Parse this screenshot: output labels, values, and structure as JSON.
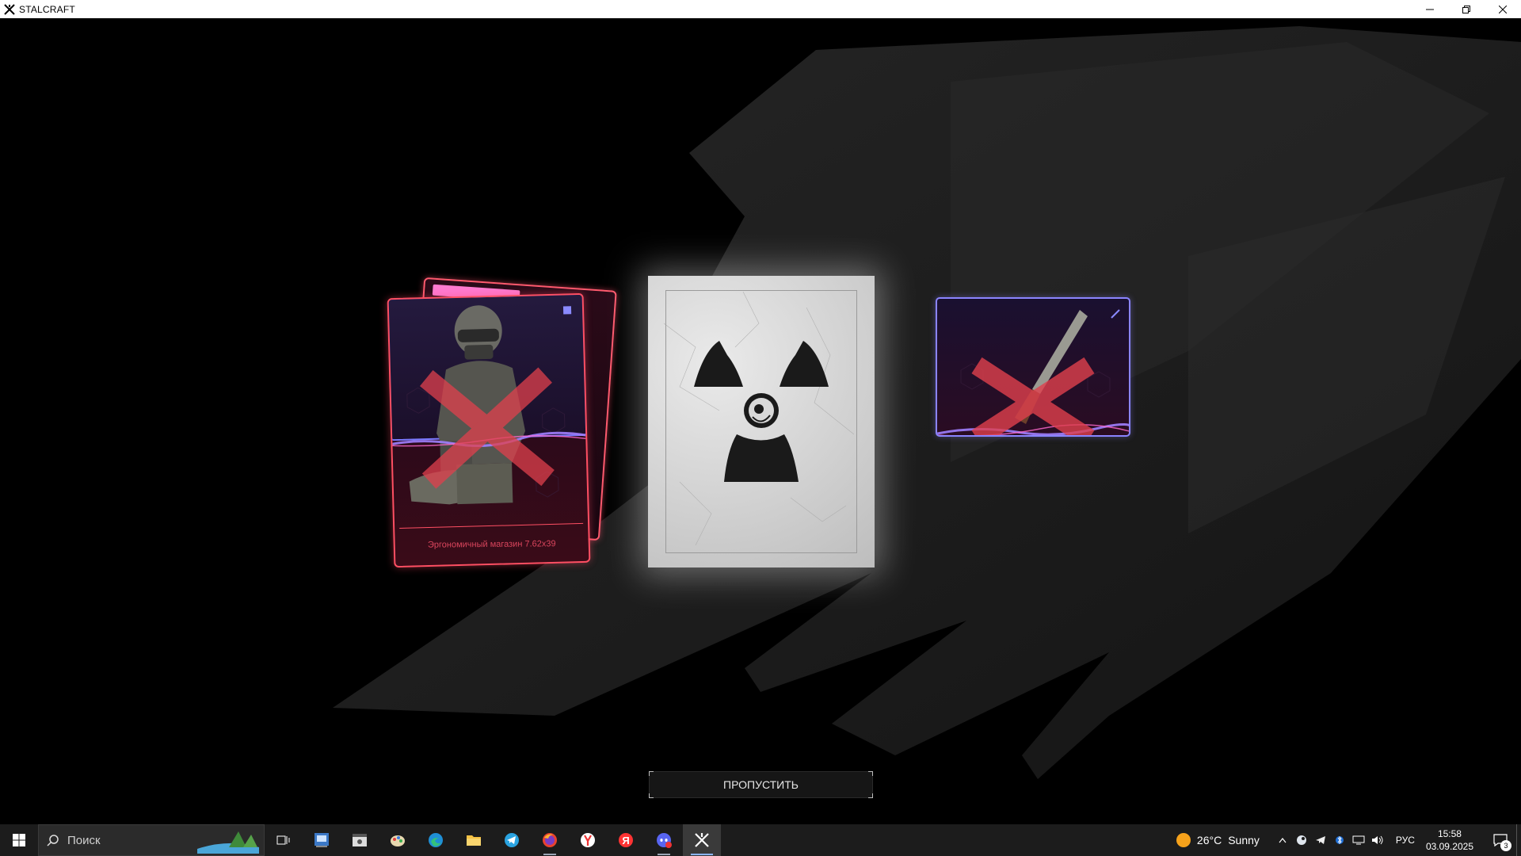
{
  "window": {
    "title": "STALCRAFT"
  },
  "cards": {
    "left_caption": "Эргономичный магазин 7.62x39"
  },
  "skip_button": {
    "label": "ПРОПУСТИТЬ"
  },
  "taskbar": {
    "search_placeholder": "Поиск",
    "weather_temp": "26°C",
    "weather_text": "Sunny",
    "language": "РУС",
    "time": "15:58",
    "date": "03.09.2025",
    "notification_count": "3"
  },
  "colors": {
    "rejected_card_border": "#ff4f63",
    "unrevealed_card_border": "#8a84ff",
    "cross": "#e0404d",
    "taskbar_bg": "#1c1c1c"
  }
}
